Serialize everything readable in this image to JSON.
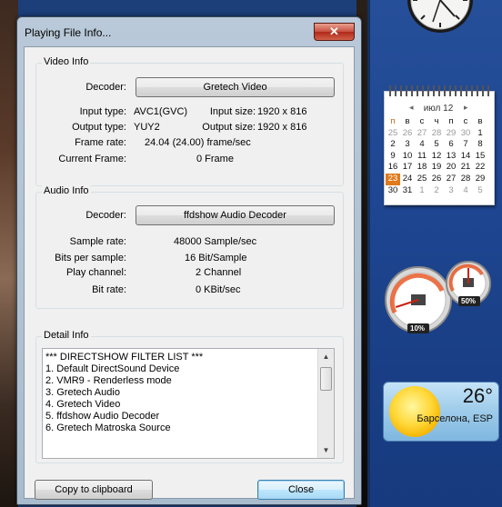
{
  "window": {
    "title": "Playing File Info...",
    "close_glyph": "✕"
  },
  "video": {
    "group_label": "Video Info",
    "decoder_label": "Decoder:",
    "decoder_value": "Gretech Video",
    "input_type_label": "Input type:",
    "input_type_value": "AVC1(GVC)",
    "input_size_label": "Input size:",
    "input_size_value": "1920 x 816",
    "output_type_label": "Output type:",
    "output_type_value": "YUY2",
    "output_size_label": "Output size:",
    "output_size_value": "1920 x 816",
    "frame_rate_label": "Frame rate:",
    "frame_rate_value": "24.04 (24.00) frame/sec",
    "current_frame_label": "Current Frame:",
    "current_frame_value": "0 Frame"
  },
  "audio": {
    "group_label": "Audio Info",
    "decoder_label": "Decoder:",
    "decoder_value": "ffdshow Audio Decoder",
    "sample_rate_label": "Sample rate:",
    "sample_rate_value": "48000 Sample/sec",
    "bits_label": "Bits per sample:",
    "bits_value": "16 Bit/Sample",
    "channel_label": "Play channel:",
    "channel_value": "2 Channel",
    "bitrate_label": "Bit rate:",
    "bitrate_value": "0 KBit/sec"
  },
  "detail": {
    "group_label": "Detail Info",
    "lines": [
      "*** DIRECTSHOW FILTER LIST ***",
      "1. Default DirectSound Device",
      "2. VMR9 - Renderless mode",
      "3. Gretech Audio",
      "4. Gretech Video",
      "5. ffdshow Audio Decoder",
      "6. Gretech Matroska Source"
    ]
  },
  "buttons": {
    "copy": "Copy to clipboard",
    "close": "Close"
  },
  "calendar": {
    "month": "июл 12",
    "prev_arrow": "◂",
    "next_arrow": "▸",
    "weekdays": [
      "п",
      "в",
      "с",
      "ч",
      "п",
      "с",
      "в"
    ],
    "weeks": [
      [
        "25",
        "26",
        "27",
        "28",
        "29",
        "30",
        "1"
      ],
      [
        "2",
        "3",
        "4",
        "5",
        "6",
        "7",
        "8"
      ],
      [
        "9",
        "10",
        "11",
        "12",
        "13",
        "14",
        "15"
      ],
      [
        "16",
        "17",
        "18",
        "19",
        "20",
        "21",
        "22"
      ],
      [
        "23",
        "24",
        "25",
        "26",
        "27",
        "28",
        "29"
      ],
      [
        "30",
        "31",
        "1",
        "2",
        "3",
        "4",
        "5"
      ]
    ],
    "today": "23"
  },
  "meter": {
    "cpu_label": "10%",
    "cpu_level": 0.1,
    "mem_label": "50%",
    "mem_level": 0.5
  },
  "weather": {
    "temperature": "26°",
    "location": "Барселона, ESP"
  }
}
